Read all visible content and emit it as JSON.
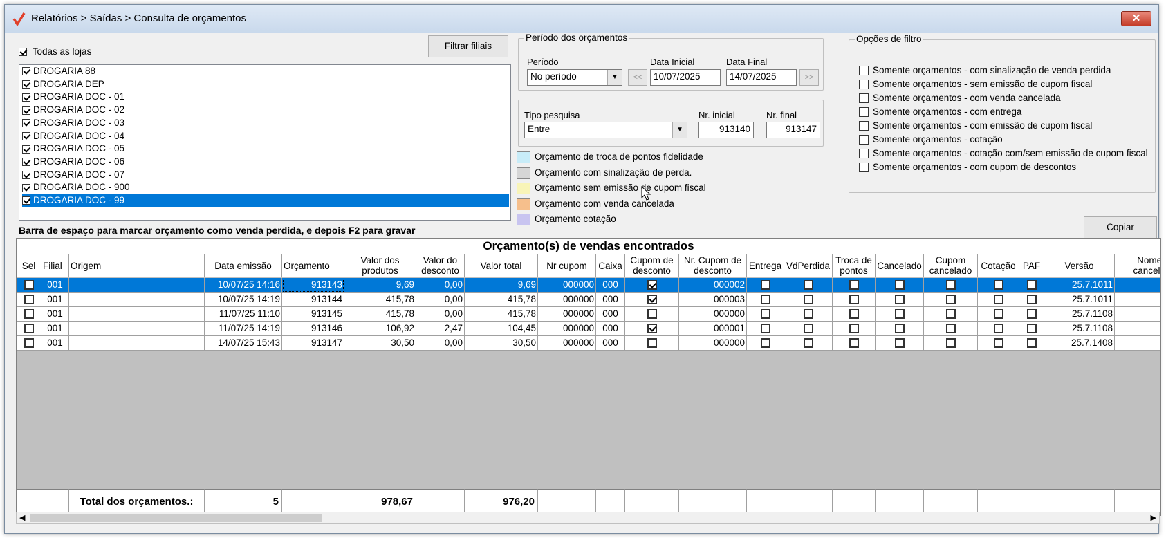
{
  "window": {
    "title": "Relatórios > Saídas > Consulta de orçamentos"
  },
  "stores": {
    "all_label": "Todas as lojas",
    "filter_button": "Filtrar filiais",
    "items": [
      "DROGARIA 88",
      "DROGARIA DEP",
      "DROGARIA DOC - 01",
      "DROGARIA DOC - 02",
      "DROGARIA DOC - 03",
      "DROGARIA DOC - 04",
      "DROGARIA DOC - 05",
      "DROGARIA DOC - 06",
      "DROGARIA DOC - 07",
      "DROGARIA DOC - 900",
      "DROGARIA DOC - 99"
    ]
  },
  "period": {
    "legend": "Período dos orçamentos",
    "label": "Período",
    "value": "No período",
    "start_label": "Data Inicial",
    "start_value": "10/07/2025",
    "end_label": "Data Final",
    "end_value": "14/07/2025",
    "prev_btn": "<<",
    "next_btn": ">>"
  },
  "search": {
    "type_label": "Tipo pesquisa",
    "type_value": "Entre",
    "initial_label": "Nr. inicial",
    "initial_value": "913140",
    "final_label": "Nr. final",
    "final_value": "913147"
  },
  "legend_items": [
    {
      "label": "Orçamento de troca de pontos fidelidade",
      "color": "#c8ecf8"
    },
    {
      "label": "Orçamento com sinalização de perda.",
      "color": "#d6d6d6"
    },
    {
      "label": "Orçamento sem emissão de cupom fiscal",
      "color": "#f8f4b8"
    },
    {
      "label": "Orçamento com venda cancelada",
      "color": "#f6bf8c"
    },
    {
      "label": "Orçamento cotação",
      "color": "#c8c4f0"
    }
  ],
  "filter_options": {
    "legend": "Opções de filtro",
    "items": [
      "Somente orçamentos - com sinalização de venda perdida",
      "Somente orçamentos - sem emissão de cupom fiscal",
      "Somente orçamentos - com venda cancelada",
      "Somente orçamentos - com entrega",
      "Somente orçamentos - com emissão de cupom fiscal",
      "Somente orçamentos - cotação",
      "Somente orçamentos - cotação com/sem emissão de cupom fiscal",
      "Somente orçamentos - com cupom de descontos"
    ]
  },
  "copy_button": "Copiar",
  "hint": "Barra de espaço para marcar orçamento como venda perdida, e depois F2 para gravar",
  "grid": {
    "title": "Orçamento(s) de vendas encontrados",
    "columns": [
      "Sel",
      "Filial",
      "Origem",
      "Data emissão",
      "Orçamento",
      "Valor dos produtos",
      "Valor do desconto",
      "Valor total",
      "Nr cupom",
      "Caixa",
      "Cupom de desconto",
      "Nr. Cupom de desconto",
      "Entrega",
      "VdPerdida",
      "Troca de pontos",
      "Cancelado",
      "Cupom cancelado",
      "Cotação",
      "PAF",
      "Versão",
      "Nome do cancelador"
    ],
    "rows": [
      {
        "filial": "001",
        "origem": "",
        "data": "10/07/25 14:16",
        "orcamento": "913143",
        "valor_prod": "9,69",
        "desconto": "0,00",
        "total": "9,69",
        "cupom": "000000",
        "caixa": "000",
        "cupom_desc": true,
        "nr_cupom_desc": "000002",
        "versao": "25.7.1011"
      },
      {
        "filial": "001",
        "origem": "",
        "data": "10/07/25 14:19",
        "orcamento": "913144",
        "valor_prod": "415,78",
        "desconto": "0,00",
        "total": "415,78",
        "cupom": "000000",
        "caixa": "000",
        "cupom_desc": true,
        "nr_cupom_desc": "000003",
        "versao": "25.7.1011"
      },
      {
        "filial": "001",
        "origem": "",
        "data": "11/07/25 11:10",
        "orcamento": "913145",
        "valor_prod": "415,78",
        "desconto": "0,00",
        "total": "415,78",
        "cupom": "000000",
        "caixa": "000",
        "cupom_desc": false,
        "nr_cupom_desc": "000000",
        "versao": "25.7.1108"
      },
      {
        "filial": "001",
        "origem": "",
        "data": "11/07/25 14:19",
        "orcamento": "913146",
        "valor_prod": "106,92",
        "desconto": "2,47",
        "total": "104,45",
        "cupom": "000000",
        "caixa": "000",
        "cupom_desc": true,
        "nr_cupom_desc": "000001",
        "versao": "25.7.1108"
      },
      {
        "filial": "001",
        "origem": "",
        "data": "14/07/25 15:43",
        "orcamento": "913147",
        "valor_prod": "30,50",
        "desconto": "0,00",
        "total": "30,50",
        "cupom": "000000",
        "caixa": "000",
        "cupom_desc": false,
        "nr_cupom_desc": "000000",
        "versao": "25.7.1408"
      }
    ],
    "totals": {
      "label": "Total dos orçamentos.:",
      "count": "5",
      "valor_prod": "978,67",
      "total": "976,20"
    }
  }
}
